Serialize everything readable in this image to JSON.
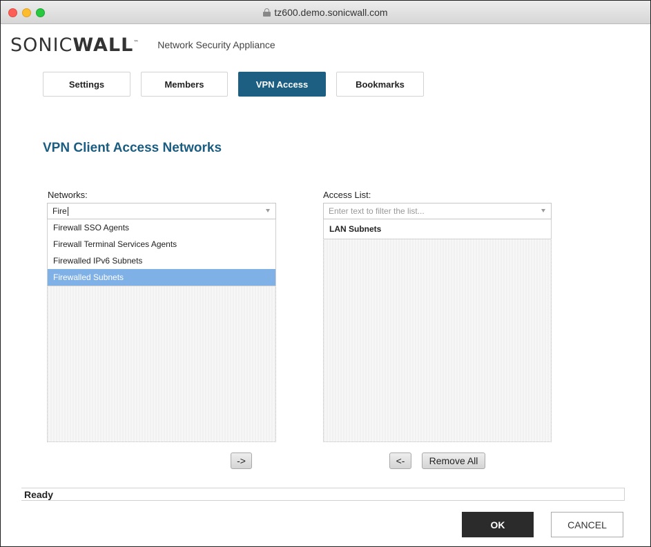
{
  "browser": {
    "url": "tz600.demo.sonicwall.com"
  },
  "header": {
    "logo_light": "SONIC",
    "logo_bold": "WALL",
    "logo_tm": "™",
    "subtitle": "Network Security Appliance"
  },
  "tabs": [
    {
      "label": "Settings",
      "active": false
    },
    {
      "label": "Members",
      "active": false
    },
    {
      "label": "VPN Access",
      "active": true
    },
    {
      "label": "Bookmarks",
      "active": false
    }
  ],
  "section_title": "VPN Client Access Networks",
  "networks": {
    "label": "Networks:",
    "filter_value": "Fire",
    "options": [
      {
        "label": "Firewall SSO Agents",
        "selected": false
      },
      {
        "label": "Firewall Terminal Services Agents",
        "selected": false
      },
      {
        "label": "Firewalled IPv6 Subnets",
        "selected": false
      },
      {
        "label": "Firewalled Subnets",
        "selected": true
      }
    ]
  },
  "access_list": {
    "label": "Access List:",
    "filter_placeholder": "Enter text to filter the list...",
    "items": [
      "LAN Subnets"
    ]
  },
  "buttons": {
    "add": "->",
    "remove": "<-",
    "remove_all": "Remove All",
    "ok": "OK",
    "cancel": "CANCEL"
  },
  "status": "Ready",
  "colors": {
    "accent": "#1c5f82",
    "selection": "#7fb0e6"
  }
}
